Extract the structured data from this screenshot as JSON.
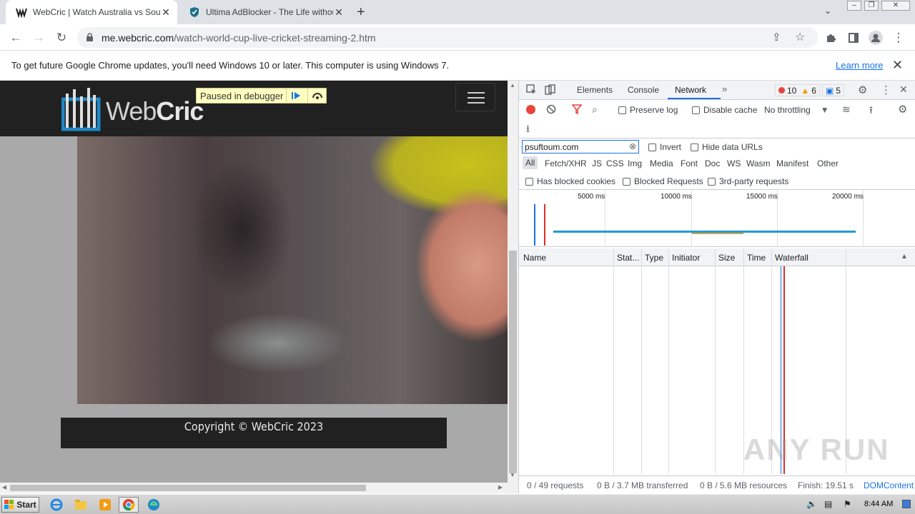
{
  "tabs": [
    {
      "title": "WebCric | Watch Australia vs South",
      "active": true
    },
    {
      "title": "Ultima AdBlocker - The Life without A",
      "active": false
    }
  ],
  "toolbar": {
    "url_host": "me.webcric.com",
    "url_path": "/watch-world-cup-live-cricket-streaming-2.htm"
  },
  "infobar": {
    "message": "To get future Google Chrome updates, you'll need Windows 10 or later. This computer is using Windows 7.",
    "learn_more": "Learn more"
  },
  "page": {
    "logo_prefix": "Web",
    "logo_bold": "Cric",
    "debugger_badge": "Paused in debugger",
    "footer": "Copyright © WebCric 2023"
  },
  "devtools": {
    "tabs": [
      "Elements",
      "Console",
      "Network"
    ],
    "active_tab": "Network",
    "errors": "10",
    "warnings": "6",
    "messages": "5",
    "preserve_log": "Preserve log",
    "disable_cache": "Disable cache",
    "throttling": "No throttling",
    "filter_value": "psuftoum.com",
    "invert": "Invert",
    "hide_data_urls": "Hide data URLs",
    "types": [
      "All",
      "Fetch/XHR",
      "JS",
      "CSS",
      "Img",
      "Media",
      "Font",
      "Doc",
      "WS",
      "Wasm",
      "Manifest",
      "Other"
    ],
    "has_blocked_cookies": "Has blocked cookies",
    "blocked_requests": "Blocked Requests",
    "third_party": "3rd-party requests",
    "timeline_labels": [
      "5000 ms",
      "10000 ms",
      "15000 ms",
      "20000 ms"
    ],
    "columns": [
      "Name",
      "Stat...",
      "Type",
      "Initiator",
      "Size",
      "Time",
      "Waterfall"
    ],
    "status": {
      "requests": "0 / 49 requests",
      "transferred": "0 B / 3.7 MB transferred",
      "resources": "0 B / 5.6 MB resources",
      "finish": "Finish: 19.51 s",
      "dom": "DOMContent"
    }
  },
  "taskbar": {
    "start": "Start",
    "clock": "8:44 AM"
  },
  "watermark": "ANY RUN",
  "colors": {
    "accent_blue": "#1a73e8",
    "record_red": "#e8453c",
    "site_dark": "#212121",
    "webcric_blue": "#1e88c8"
  }
}
